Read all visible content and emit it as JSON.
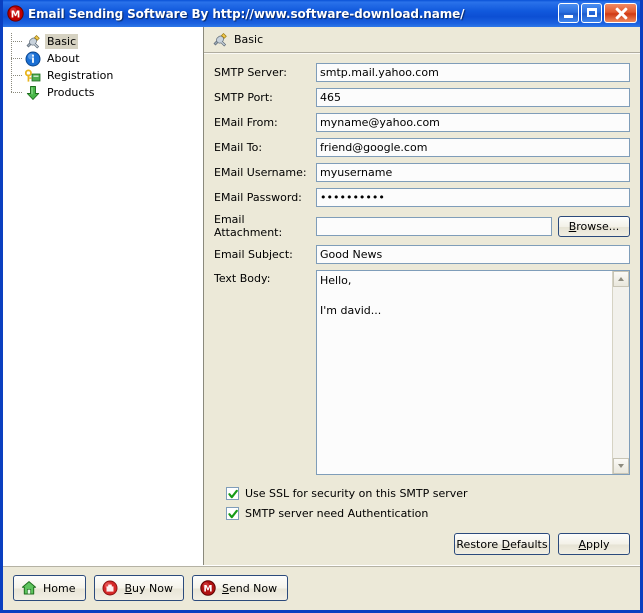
{
  "window": {
    "title": "Email Sending Software  By http://www.software-download.name/",
    "icon": "mail-app-icon",
    "controls": {
      "minimize": "minimize-button",
      "maximize": "maximize-button",
      "close": "close-button"
    }
  },
  "sidebar": {
    "items": [
      {
        "label": "Basic",
        "icon": "tools-icon",
        "selected": true
      },
      {
        "label": "About",
        "icon": "info-icon",
        "selected": false
      },
      {
        "label": "Registration",
        "icon": "key-icon",
        "selected": false
      },
      {
        "label": "Products",
        "icon": "download-arrow-icon",
        "selected": false
      }
    ]
  },
  "pane": {
    "header": {
      "title": "Basic",
      "icon": "tools-icon"
    },
    "fields": [
      {
        "label": "SMTP Server:",
        "value": "smtp.mail.yahoo.com",
        "name": "smtp-server"
      },
      {
        "label": "SMTP Port:",
        "value": "465",
        "name": "smtp-port"
      },
      {
        "label": "EMail From:",
        "value": "myname@yahoo.com",
        "name": "email-from"
      },
      {
        "label": "EMail To:",
        "value": "friend@google.com",
        "name": "email-to"
      },
      {
        "label": "EMail Username:",
        "value": "myusername",
        "name": "email-username"
      },
      {
        "label": "EMail Password:",
        "value": "••••••••••",
        "name": "email-password"
      }
    ],
    "attachment": {
      "label": "Email Attachment:",
      "value": "",
      "browse_label": "Browse...",
      "browse_mnemonic": "B"
    },
    "subject": {
      "label": "Email Subject:",
      "value": "Good News"
    },
    "text_body": {
      "label": "Text Body:",
      "value": "Hello,\n\nI'm david..."
    },
    "checkboxes": [
      {
        "label": "Use SSL for security on this SMTP server",
        "checked": true,
        "name": "use-ssl"
      },
      {
        "label": "SMTP server need Authentication",
        "checked": true,
        "name": "need-auth"
      }
    ],
    "buttons": {
      "restore_defaults": "Restore Defaults",
      "restore_mnemonic": "D",
      "apply": "Apply",
      "apply_mnemonic": "A"
    }
  },
  "bottombar": {
    "buttons": [
      {
        "label": "Home",
        "icon": "house-icon",
        "mnemonic": ""
      },
      {
        "label": "Buy Now",
        "icon": "cart-icon",
        "mnemonic": "B"
      },
      {
        "label": "Send Now",
        "icon": "mail-app-icon",
        "mnemonic": "S"
      }
    ]
  },
  "colors": {
    "titlebar_blue": "#0a52d6",
    "window_border": "#0a3fc0",
    "panel_bg": "#ece9d8",
    "field_border": "#7f9db9",
    "check_green": "#179b17",
    "selection": "#d6d2c2"
  }
}
